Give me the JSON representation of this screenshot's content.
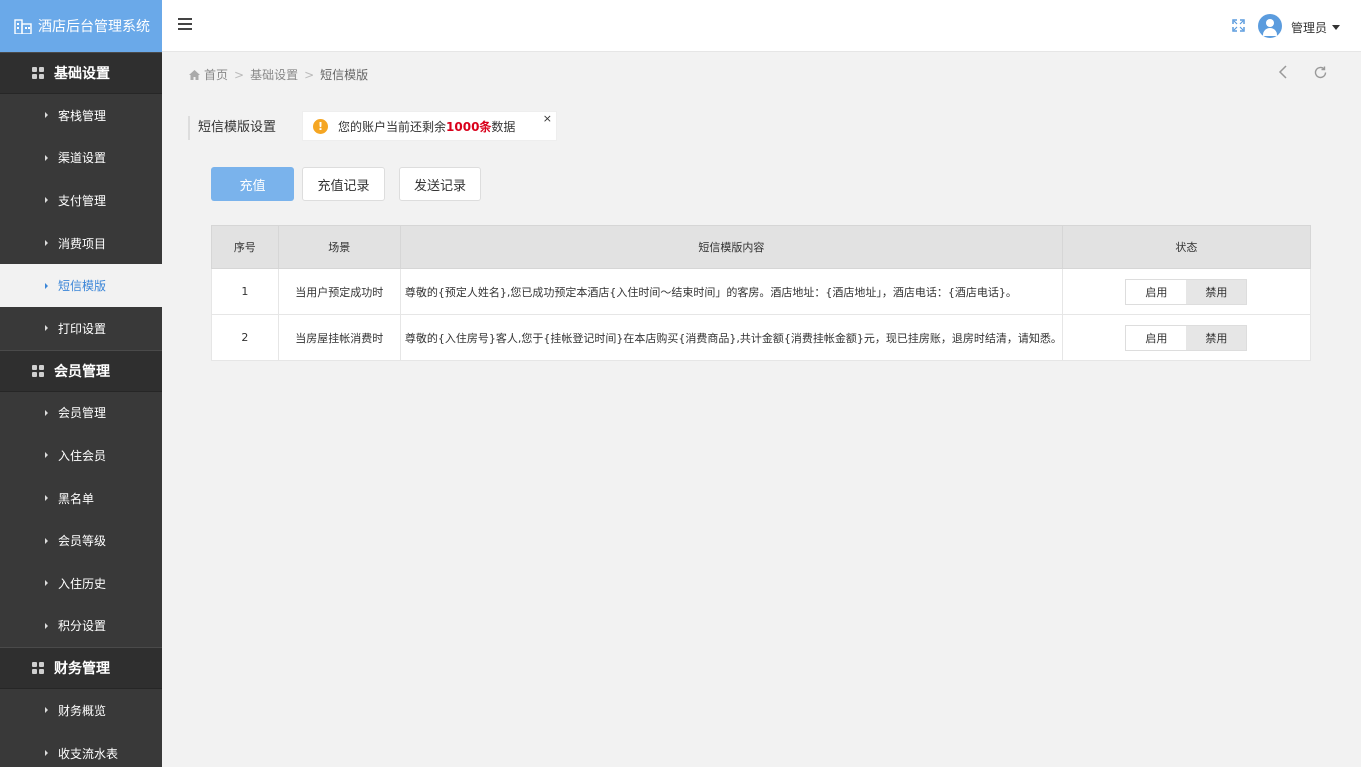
{
  "app": {
    "title": "酒店后台管理系统"
  },
  "sidebar": {
    "groups": [
      {
        "title": "基础设置",
        "items": [
          "客栈管理",
          "渠道设置",
          "支付管理",
          "消费项目",
          "短信模版",
          "打印设置"
        ]
      },
      {
        "title": "会员管理",
        "items": [
          "会员管理",
          "入住会员",
          "黑名单",
          "会员等级",
          "入住历史",
          "积分设置"
        ]
      },
      {
        "title": "财务管理",
        "items": [
          "财务概览",
          "收支流水表"
        ]
      }
    ],
    "active_item": "短信模版"
  },
  "header": {
    "user": "管理员"
  },
  "breadcrumb": {
    "home": "首页",
    "level1": "基础设置",
    "current": "短信模版"
  },
  "section": {
    "title": "短信模版设置"
  },
  "notice": {
    "prefix": "您的账户当前还剩余",
    "count": "1000条",
    "suffix": "数据",
    "close": "×"
  },
  "buttons": {
    "recharge": "充值",
    "recharge_record": "充值记录",
    "send_record": "发送记录"
  },
  "table": {
    "headers": [
      "序号",
      "场景",
      "短信模版内容",
      "状态"
    ],
    "rows": [
      {
        "no": "1",
        "scene": "当用户预定成功时",
        "content": "尊敬的{预定人姓名},您已成功预定本酒店{入住时间～结束时间」的客房。酒店地址：{酒店地址」，酒店电话：{酒店电话}。",
        "enable": "启用",
        "disable": "禁用"
      },
      {
        "no": "2",
        "scene": "当房屋挂帐消费时",
        "content": "尊敬的{入住房号}客人,您于{挂帐登记时间}在本店购买{消费商品},共计金额{消费挂帐金额}元，现已挂房账，退房时结清，请知悉。",
        "enable": "启用",
        "disable": "禁用"
      }
    ]
  },
  "colors": {
    "logo_bg": "#6aa9e9",
    "sidebar_bg": "#393939",
    "primary_button": "#7ab3ec",
    "active_text": "#3b86d8",
    "highlight": "#d9001b"
  }
}
